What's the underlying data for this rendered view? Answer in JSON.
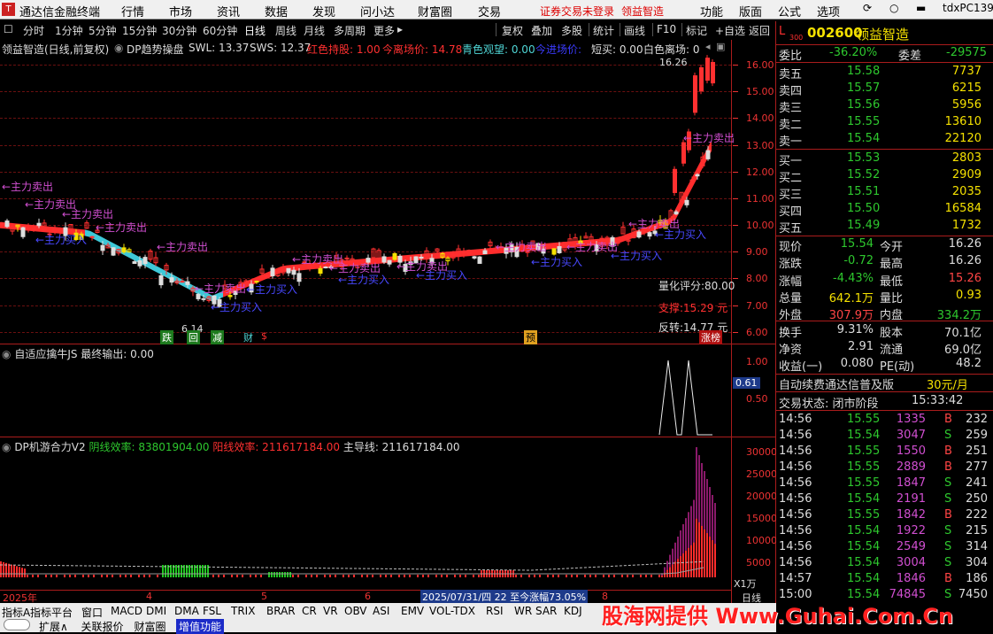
{
  "app": {
    "title": "通达信金融终端",
    "logo": "T",
    "menu": [
      "行情",
      "市场",
      "资讯",
      "数据",
      "发现",
      "问小达",
      "财富圈",
      "交易"
    ],
    "warn": [
      "证券交易未登录",
      "领益智造"
    ],
    "right_menu": [
      "功能",
      "版面",
      "公式",
      "选项"
    ],
    "user": "tdxPC1397"
  },
  "toolbar": {
    "periods": [
      "分时",
      "1分钟",
      "5分钟",
      "15分钟",
      "30分钟",
      "60分钟",
      "日线",
      "周线",
      "月线",
      "多周期",
      "更多"
    ],
    "actions": [
      "复权",
      "叠加",
      "多股",
      "统计",
      "画线",
      "F10",
      "标记",
      "+自选",
      "返回"
    ]
  },
  "main_info": {
    "name": "领益智造(日线,前复权)",
    "indicator": "DP趋势操盘",
    "swl": "SWL: 13.37",
    "sws": "SWS: 12.37",
    "red_hold": "红色持股: 1.00",
    "leave_price": "今离场价: 14.78",
    "cyan_watch": "青色观望: 0.00",
    "enter_price": "今进场价:",
    "short_buy": "短买: 0.00",
    "white_leave": "白色离场: 0"
  },
  "price_axis": [
    "16.00",
    "15.00",
    "14.00",
    "13.00",
    "12.00",
    "11.00",
    "10.00",
    "9.00",
    "8.00",
    "7.00",
    "6.00"
  ],
  "chart_labels": {
    "high": "16.26",
    "low": "6.14",
    "score": "量化评分:80.00",
    "support": "支撑:15.29 元",
    "reverse": "反转:14.77 元",
    "markers": [
      "跌",
      "回",
      "减",
      "财",
      "$",
      "预",
      "涨榜"
    ],
    "annotations": [
      "←主力卖出",
      "←主力卖出",
      "←主力卖出",
      "←主力买入",
      "←主力卖出",
      "←主力买入",
      "←主力卖出",
      "←主力买入",
      "←主力卖出",
      "←主力买入",
      "←主力卖出",
      "←主力买入",
      "←主力卖出",
      "←主力买入",
      "←主力卖出",
      "←主力卖出",
      "←主力买入",
      "←主力卖出",
      "←主力买入",
      "←主力卖出",
      "←主力卖出"
    ]
  },
  "ind1": {
    "info": "自适应擒牛JS  最终输出: 0.00",
    "axis": [
      "1.00",
      "0.50"
    ],
    "cur": "0.61"
  },
  "ind2": {
    "info_name": "DP机游合力V2",
    "yin": "阴线效率: 83801904.00",
    "yang": "阳线效率: 211617184.00",
    "main": "主导线: 211617184.00",
    "axis": [
      "30000",
      "25000",
      "20000",
      "15000",
      "10000",
      "5000"
    ],
    "unit": "X1万"
  },
  "dates": [
    "2025年",
    "4",
    "5",
    "6",
    "8"
  ],
  "range_info": "2025/07/31/四 22 至今涨幅73.05%",
  "period_lbl": "日线",
  "right": {
    "code_prefix": "L",
    "code_sub": "300",
    "code": "002600",
    "name": "领益智造",
    "weibi": {
      "l": "委比",
      "v": "-36.20%",
      "l2": "委差",
      "v2": "-29575"
    },
    "sells": [
      {
        "l": "卖五",
        "p": "15.58",
        "v": "7737"
      },
      {
        "l": "卖四",
        "p": "15.57",
        "v": "6215"
      },
      {
        "l": "卖三",
        "p": "15.56",
        "v": "5956"
      },
      {
        "l": "卖二",
        "p": "15.55",
        "v": "13610"
      },
      {
        "l": "卖一",
        "p": "15.54",
        "v": "22120"
      }
    ],
    "buys": [
      {
        "l": "买一",
        "p": "15.53",
        "v": "2803"
      },
      {
        "l": "买二",
        "p": "15.52",
        "v": "2909"
      },
      {
        "l": "买三",
        "p": "15.51",
        "v": "2035"
      },
      {
        "l": "买四",
        "p": "15.50",
        "v": "16584"
      },
      {
        "l": "买五",
        "p": "15.49",
        "v": "1732"
      }
    ],
    "stats": [
      {
        "l": "现价",
        "v": "15.54",
        "c": "green",
        "l2": "今开",
        "v2": "16.26",
        "c2": "white"
      },
      {
        "l": "涨跌",
        "v": "-0.72",
        "c": "green",
        "l2": "最高",
        "v2": "16.26",
        "c2": "white"
      },
      {
        "l": "涨幅",
        "v": "-4.43%",
        "c": "green",
        "l2": "最低",
        "v2": "15.26",
        "c2": "red"
      },
      {
        "l": "总量",
        "v": "642.1万",
        "c": "yellow",
        "l2": "量比",
        "v2": "0.93",
        "c2": "yellow"
      },
      {
        "l": "外盘",
        "v": "307.9万",
        "c": "red",
        "l2": "内盘",
        "v2": "334.2万",
        "c2": "green"
      },
      {
        "l": "换手",
        "v": "9.31%",
        "c": "white",
        "l2": "股本",
        "v2": "70.1亿",
        "c2": "white"
      },
      {
        "l": "净资",
        "v": "2.91",
        "c": "white",
        "l2": "流通",
        "v2": "69.0亿",
        "c2": "white"
      },
      {
        "l": "收益(一)",
        "v": "0.080",
        "c": "white",
        "l2": "PE(动)",
        "v2": "48.2",
        "c2": "white"
      }
    ],
    "ad": "自动续费通达信普及版",
    "ad_price": "30元/月",
    "trade_state": "交易状态: 闭市阶段",
    "trade_time": "15:33:42",
    "ticks": [
      {
        "t": "14:56",
        "p": "15.55",
        "v": "1335",
        "bs": "B",
        "n": "232"
      },
      {
        "t": "14:56",
        "p": "15.54",
        "v": "3047",
        "bs": "S",
        "n": "259"
      },
      {
        "t": "14:56",
        "p": "15.55",
        "v": "1550",
        "bs": "B",
        "n": "251"
      },
      {
        "t": "14:56",
        "p": "15.55",
        "v": "2889",
        "bs": "B",
        "n": "277"
      },
      {
        "t": "14:56",
        "p": "15.55",
        "v": "1847",
        "bs": "S",
        "n": "241"
      },
      {
        "t": "14:56",
        "p": "15.54",
        "v": "2191",
        "bs": "S",
        "n": "250"
      },
      {
        "t": "14:56",
        "p": "15.55",
        "v": "1842",
        "bs": "B",
        "n": "222"
      },
      {
        "t": "14:56",
        "p": "15.54",
        "v": "1922",
        "bs": "S",
        "n": "215"
      },
      {
        "t": "14:56",
        "p": "15.54",
        "v": "2549",
        "bs": "S",
        "n": "314"
      },
      {
        "t": "14:56",
        "p": "15.54",
        "v": "3004",
        "bs": "S",
        "n": "304"
      },
      {
        "t": "14:57",
        "p": "15.54",
        "v": "1846",
        "bs": "B",
        "n": "186"
      },
      {
        "t": "15:00",
        "p": "15.54",
        "v": "74845",
        "bs": "S",
        "n": "7450"
      }
    ]
  },
  "bottom_tabs_row1": [
    "指标A",
    "指标平台",
    "窗口",
    "MACD",
    "DMI",
    "DMA",
    "FSL",
    "TRIX",
    "BRAR",
    "CR",
    "VR",
    "OBV",
    "ASI",
    "EMV",
    "VOL-TDX",
    "RSI",
    "WR",
    "SAR",
    "KDJ"
  ],
  "bottom_tabs_row2": [
    "扩展∧",
    "关联报价",
    "财富圈",
    "增值功能"
  ],
  "watermark": "股海网提供 Www.Guhai.Com.Cn"
}
